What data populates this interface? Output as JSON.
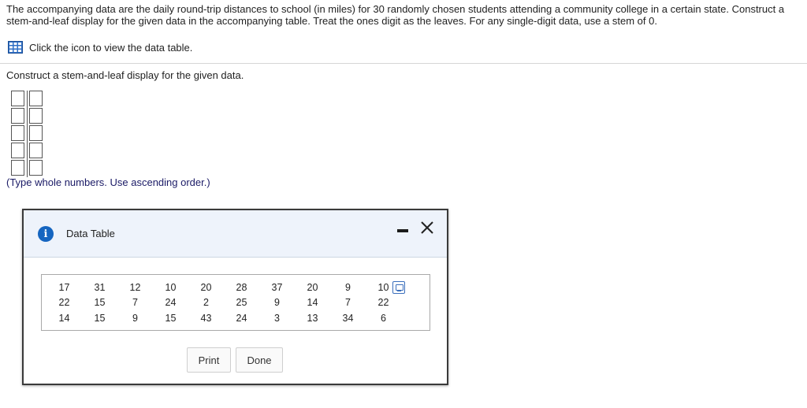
{
  "question": {
    "text": "The accompanying data are the daily round-trip distances to school (in miles) for 30 randomly chosen students attending a community college in a certain state. Construct a stem-and-leaf display for the given data in the accompanying table. Treat the ones digit as the leaves. For any single-digit data, use a stem of 0."
  },
  "data_link": {
    "label": "Click the icon to view the data table.",
    "icon": "table-grid-icon"
  },
  "instruction": "Construct a stem-and-leaf display for the given data.",
  "stem_leaf": {
    "rows": [
      {
        "stem": "",
        "leaves": ""
      },
      {
        "stem": "",
        "leaves": ""
      },
      {
        "stem": "",
        "leaves": ""
      },
      {
        "stem": "",
        "leaves": ""
      },
      {
        "stem": "",
        "leaves": ""
      }
    ]
  },
  "hint": "(Type whole numbers. Use ascending order.)",
  "dialog": {
    "title": "Data Table",
    "info_icon": "info-icon",
    "rows": [
      [
        "17",
        "31",
        "12",
        "10",
        "20",
        "28",
        "37",
        "20",
        "9",
        "10"
      ],
      [
        "22",
        "15",
        "7",
        "24",
        "2",
        "25",
        "9",
        "14",
        "7",
        "22"
      ],
      [
        "14",
        "15",
        "9",
        "15",
        "43",
        "24",
        "3",
        "13",
        "34",
        "6"
      ]
    ],
    "print_label": "Print",
    "done_label": "Done"
  },
  "colors": {
    "accent": "#1565c0",
    "header_bg": "#eef3fb",
    "hint_text": "#1a1a66"
  }
}
